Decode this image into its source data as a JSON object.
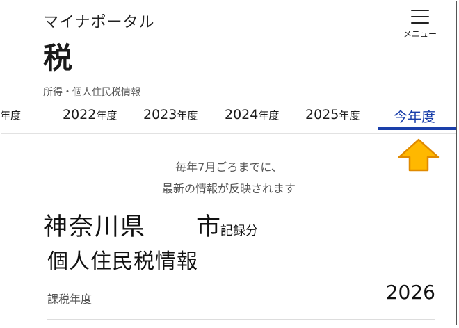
{
  "header": {
    "app_name": "マイナポータル",
    "menu_label": "メニュー"
  },
  "page": {
    "title": "税",
    "breadcrumb": "所得・個人住民税情報"
  },
  "tabs": [
    {
      "label": "年度",
      "year": "",
      "suffix": "年度",
      "active": false
    },
    {
      "label": "2022年度",
      "year": "2022",
      "suffix": "年度",
      "active": false
    },
    {
      "label": "2023年度",
      "year": "2023",
      "suffix": "年度",
      "active": false
    },
    {
      "label": "2024年度",
      "year": "2024",
      "suffix": "年度",
      "active": false
    },
    {
      "label": "2025年度",
      "year": "2025",
      "suffix": "年度",
      "active": false
    },
    {
      "label": "今年度",
      "year": "",
      "suffix": "",
      "active": true
    }
  ],
  "colors": {
    "active_tab": "#1a3faa",
    "arrow_fill": "#ffb800",
    "arrow_stroke": "#e08a00"
  },
  "annotation": {
    "icon": "up-arrow-icon"
  },
  "notice": {
    "line1": "毎年7月ごろまでに、",
    "line2": "最新の情報が反映されます"
  },
  "record": {
    "prefecture": "神奈川県",
    "city": "市",
    "city_suffix": "記録分"
  },
  "section": {
    "title": "個人住民税情報"
  },
  "field": {
    "label": "課税年度",
    "value": "2026"
  }
}
